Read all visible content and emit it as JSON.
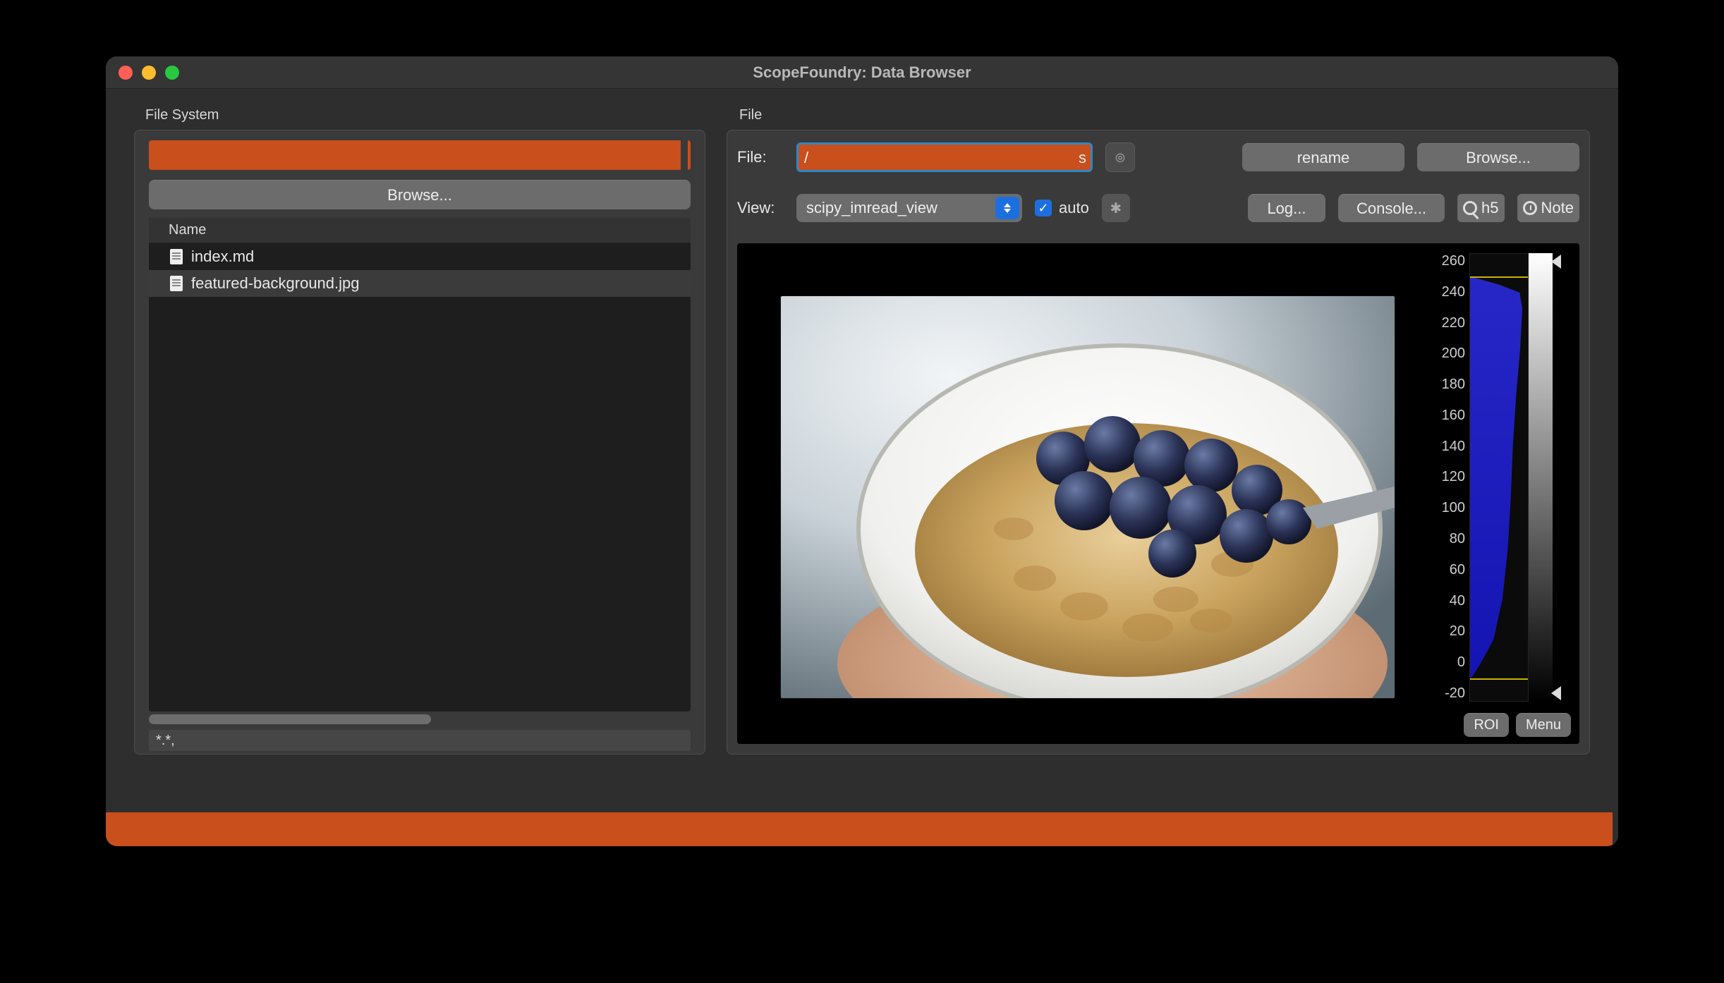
{
  "window": {
    "title": "ScopeFoundry: Data Browser"
  },
  "fs": {
    "label": "File System",
    "browse": "Browse...",
    "tree_header": "Name",
    "files": [
      "index.md",
      "featured-background.jpg"
    ],
    "filter": "*.*,"
  },
  "file": {
    "label": "File",
    "file_lab": "File:",
    "rename": "rename",
    "browse": "Browse...",
    "view_lab": "View:",
    "view_value": "scipy_imread_view",
    "auto": "auto",
    "log": "Log...",
    "console": "Console...",
    "h5": "h5",
    "note": "Note"
  },
  "hist": {
    "ticks": [
      "260",
      "240",
      "220",
      "200",
      "180",
      "160",
      "140",
      "120",
      "100",
      "80",
      "60",
      "40",
      "20",
      "0",
      "-20"
    ],
    "roi": "ROI",
    "menu": "Menu"
  },
  "colors": {
    "redact": "#c94f1c",
    "accent": "#1d6fe0"
  }
}
